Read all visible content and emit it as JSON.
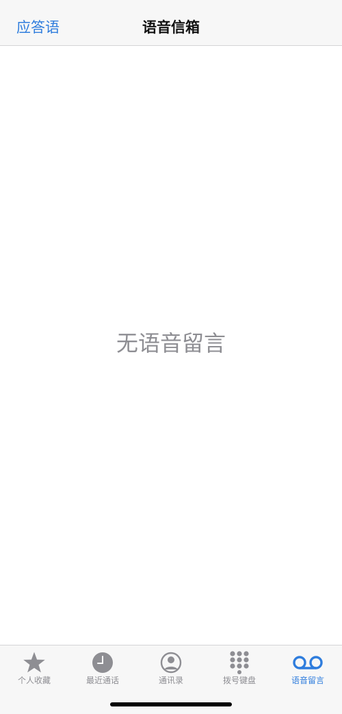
{
  "navbar": {
    "left_button": "应答语",
    "title": "语音信箱"
  },
  "main": {
    "empty_message": "无语音留言"
  },
  "tabbar": {
    "tabs": [
      {
        "label": "个人收藏",
        "icon": "star-icon",
        "active": false
      },
      {
        "label": "最近通话",
        "icon": "clock-icon",
        "active": false
      },
      {
        "label": "通讯录",
        "icon": "person-circle-icon",
        "active": false
      },
      {
        "label": "拨号键盘",
        "icon": "keypad-icon",
        "active": false
      },
      {
        "label": "语音留言",
        "icon": "voicemail-icon",
        "active": true
      }
    ]
  },
  "colors": {
    "accent": "#2f7ddd",
    "inactive": "#8e8e93",
    "bar_background": "#f7f7f7"
  }
}
